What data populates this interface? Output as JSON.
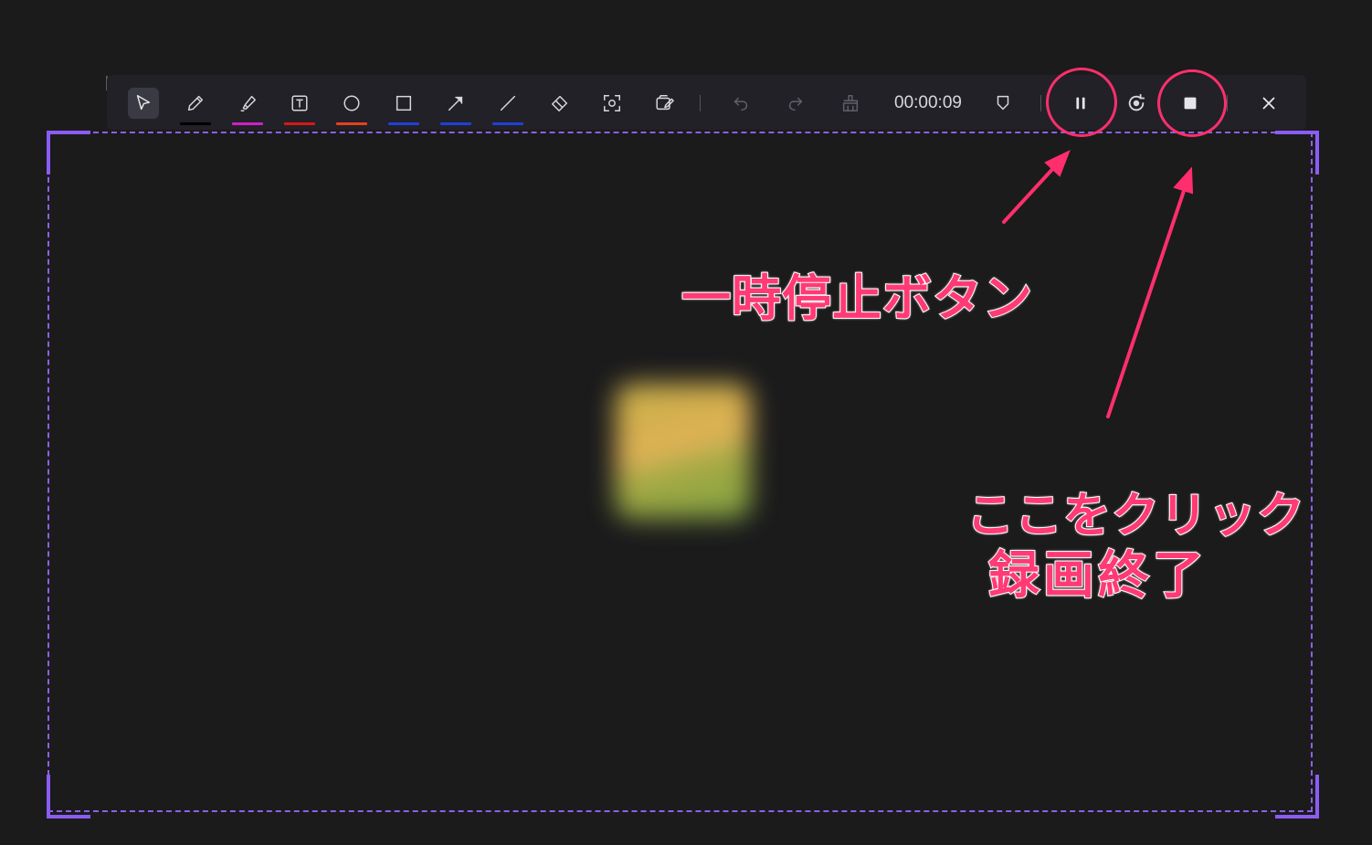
{
  "toolbar": {
    "timer": "00:00:09",
    "tools": [
      {
        "id": "select",
        "icon": "cursor-arrow-icon",
        "underline": ""
      },
      {
        "id": "pen",
        "icon": "pencil-icon",
        "underline": "#000000"
      },
      {
        "id": "highlighter",
        "icon": "highlighter-icon",
        "underline": "#d020c8"
      },
      {
        "id": "text",
        "icon": "text-box-icon",
        "underline": "#d81818"
      },
      {
        "id": "circle",
        "icon": "circle-icon",
        "underline": "#e8401c"
      },
      {
        "id": "rectangle",
        "icon": "rectangle-icon",
        "underline": "#1e40d8"
      },
      {
        "id": "arrow",
        "icon": "arrow-icon",
        "underline": "#1e40d8"
      },
      {
        "id": "line",
        "icon": "line-icon",
        "underline": "#1e40d8"
      },
      {
        "id": "eraser",
        "icon": "eraser-icon",
        "underline": ""
      },
      {
        "id": "screenshot",
        "icon": "screenshot-icon",
        "underline": ""
      },
      {
        "id": "whiteboard",
        "icon": "whiteboard-icon",
        "underline": ""
      }
    ],
    "actions": [
      "undo-icon",
      "redo-icon",
      "clear-icon",
      "shield-icon",
      "pause-icon",
      "restart-icon",
      "stop-icon",
      "close-icon"
    ]
  },
  "annotations": {
    "pause_label": "一時停止ボタン",
    "stop_label_line1": "ここをクリック",
    "stop_label_line2": "録画終了"
  },
  "colors": {
    "background": "#1b1b1c",
    "toolbar": "#222127",
    "frame": "#8b5cf6",
    "annotation": "#ff2f6d"
  }
}
